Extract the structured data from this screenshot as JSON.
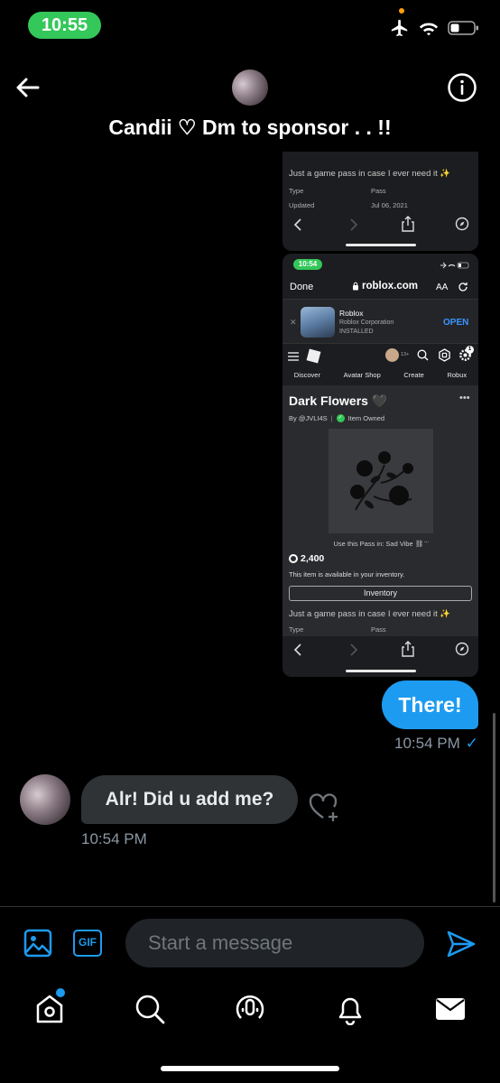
{
  "status_bar": {
    "time": "10:55"
  },
  "header": {
    "title": "Candii ♡ Dm to sponsor . . !!"
  },
  "screenshot_top": {
    "description_line": "Just a game pass in case I ever need it ✨",
    "row1_label": "Type",
    "row1_value": "Pass",
    "row2_label": "Updated",
    "row2_value": "Jul 06, 2021"
  },
  "screenshot_main": {
    "time": "10:54",
    "done_label": "Done",
    "url": "roblox.com",
    "aa_label": "AA",
    "app_name": "Roblox",
    "app_publisher": "Roblox Corporation",
    "app_status": "INSTALLED",
    "open_label": "OPEN",
    "age_badge": "13+",
    "notif_count": "1",
    "tabs": [
      "Discover",
      "Avatar Shop",
      "Create",
      "Robux"
    ],
    "item_title": "Dark Flowers 🖤",
    "creator_line": "By @JVLI4S",
    "owned_label": "Item Owned",
    "use_pass_line": "Use this Pass in: Sad Vibe ⛓ ̈ ̈",
    "price": "2,400",
    "inventory_note": "This item is available in your inventory.",
    "inventory_button": "Inventory",
    "description_line": "Just a game pass in case I ever need it ✨",
    "row1_label": "Type",
    "row1_value": "Pass"
  },
  "messages": {
    "outgoing_text": "There!",
    "outgoing_time": "10:54 PM",
    "incoming_text": "Alr! Did u add me?",
    "incoming_time": "10:54 PM"
  },
  "composer": {
    "gif_label": "GIF",
    "placeholder": "Start a message"
  },
  "colors": {
    "accent": "#1d9bf0",
    "status_green": "#34c759",
    "bubble_in": "#2f3336"
  }
}
